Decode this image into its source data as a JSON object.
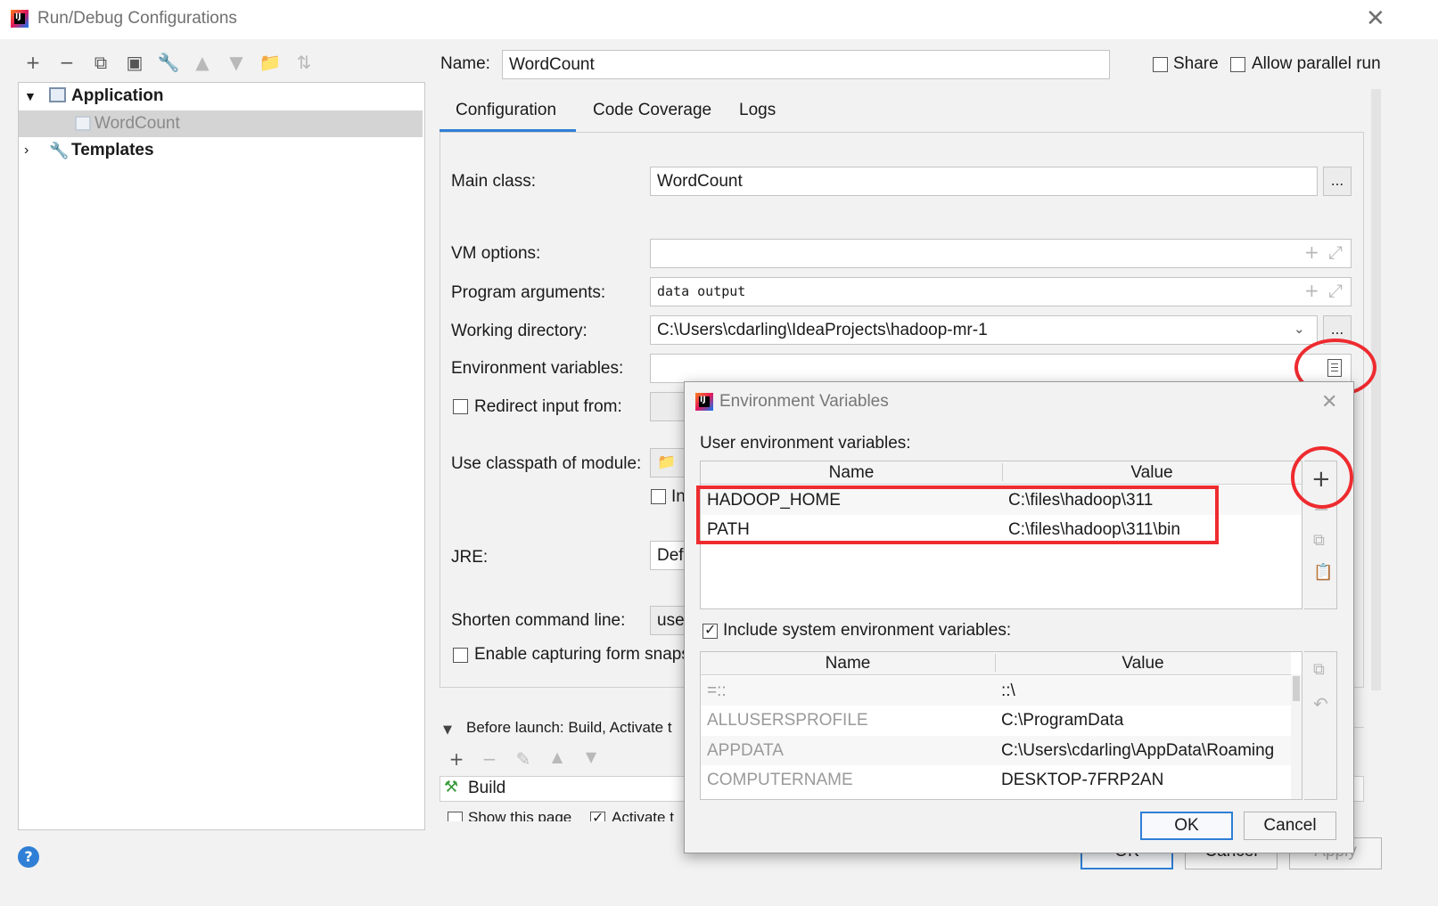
{
  "window": {
    "title": "Run/Debug Configurations"
  },
  "toolbar": {
    "icons": [
      "add-icon",
      "remove-icon",
      "copy-icon",
      "save-icon",
      "wrench-icon",
      "move-up-icon",
      "move-down-icon",
      "folder-add-icon",
      "sort-icon"
    ]
  },
  "tree": {
    "application": "Application",
    "wordcount": "WordCount",
    "templates": "Templates"
  },
  "header": {
    "name_label": "Name:",
    "name_value": "WordCount",
    "share": "Share",
    "allow_parallel": "Allow parallel run"
  },
  "tabs": [
    {
      "label": "Configuration"
    },
    {
      "label": "Code Coverage"
    },
    {
      "label": "Logs"
    }
  ],
  "form": {
    "main_class_label": "Main class:",
    "main_class_value": "WordCount",
    "vm_options_label": "VM options:",
    "program_args_label": "Program arguments:",
    "program_args_value": "data output",
    "working_dir_label": "Working directory:",
    "working_dir_value": "C:\\Users\\cdarling\\IdeaProjects\\hadoop-mr-1",
    "env_vars_label": "Environment variables:",
    "redirect_label": "Redirect input from:",
    "classpath_label": "Use classpath of module:",
    "classpath_cb_label": "In",
    "jre_label": "JRE:",
    "jre_value": "Def",
    "shorten_label": "Shorten command line:",
    "shorten_value": "use",
    "capture_label": "Enable capturing form snaps",
    "ellipsis": "..."
  },
  "before_launch": {
    "label": "Before launch: Build, Activate t",
    "build": "Build",
    "show_page": "Show this page",
    "activate": "Activate t"
  },
  "footer": {
    "ok": "OK",
    "cancel": "Cancel",
    "apply": "Apply"
  },
  "dialog": {
    "title": "Environment Variables",
    "user_label": "User environment variables:",
    "col_name": "Name",
    "col_value": "Value",
    "user_vars": [
      {
        "name": "HADOOP_HOME",
        "value": "C:\\files\\hadoop\\311"
      },
      {
        "name": "PATH",
        "value": "C:\\files\\hadoop\\311\\bin"
      }
    ],
    "include_label": "Include system environment variables:",
    "system_vars": [
      {
        "name": "=::",
        "value": "::\\"
      },
      {
        "name": "ALLUSERSPROFILE",
        "value": "C:\\ProgramData"
      },
      {
        "name": "APPDATA",
        "value": "C:\\Users\\cdarling\\AppData\\Roaming"
      },
      {
        "name": "COMPUTERNAME",
        "value": "DESKTOP-7FRP2AN"
      }
    ],
    "ok": "OK",
    "cancel": "Cancel"
  },
  "colors": {
    "accent": "#2f7fd6",
    "highlight": "#ee2b2f",
    "selection": "#d4d4d4"
  }
}
